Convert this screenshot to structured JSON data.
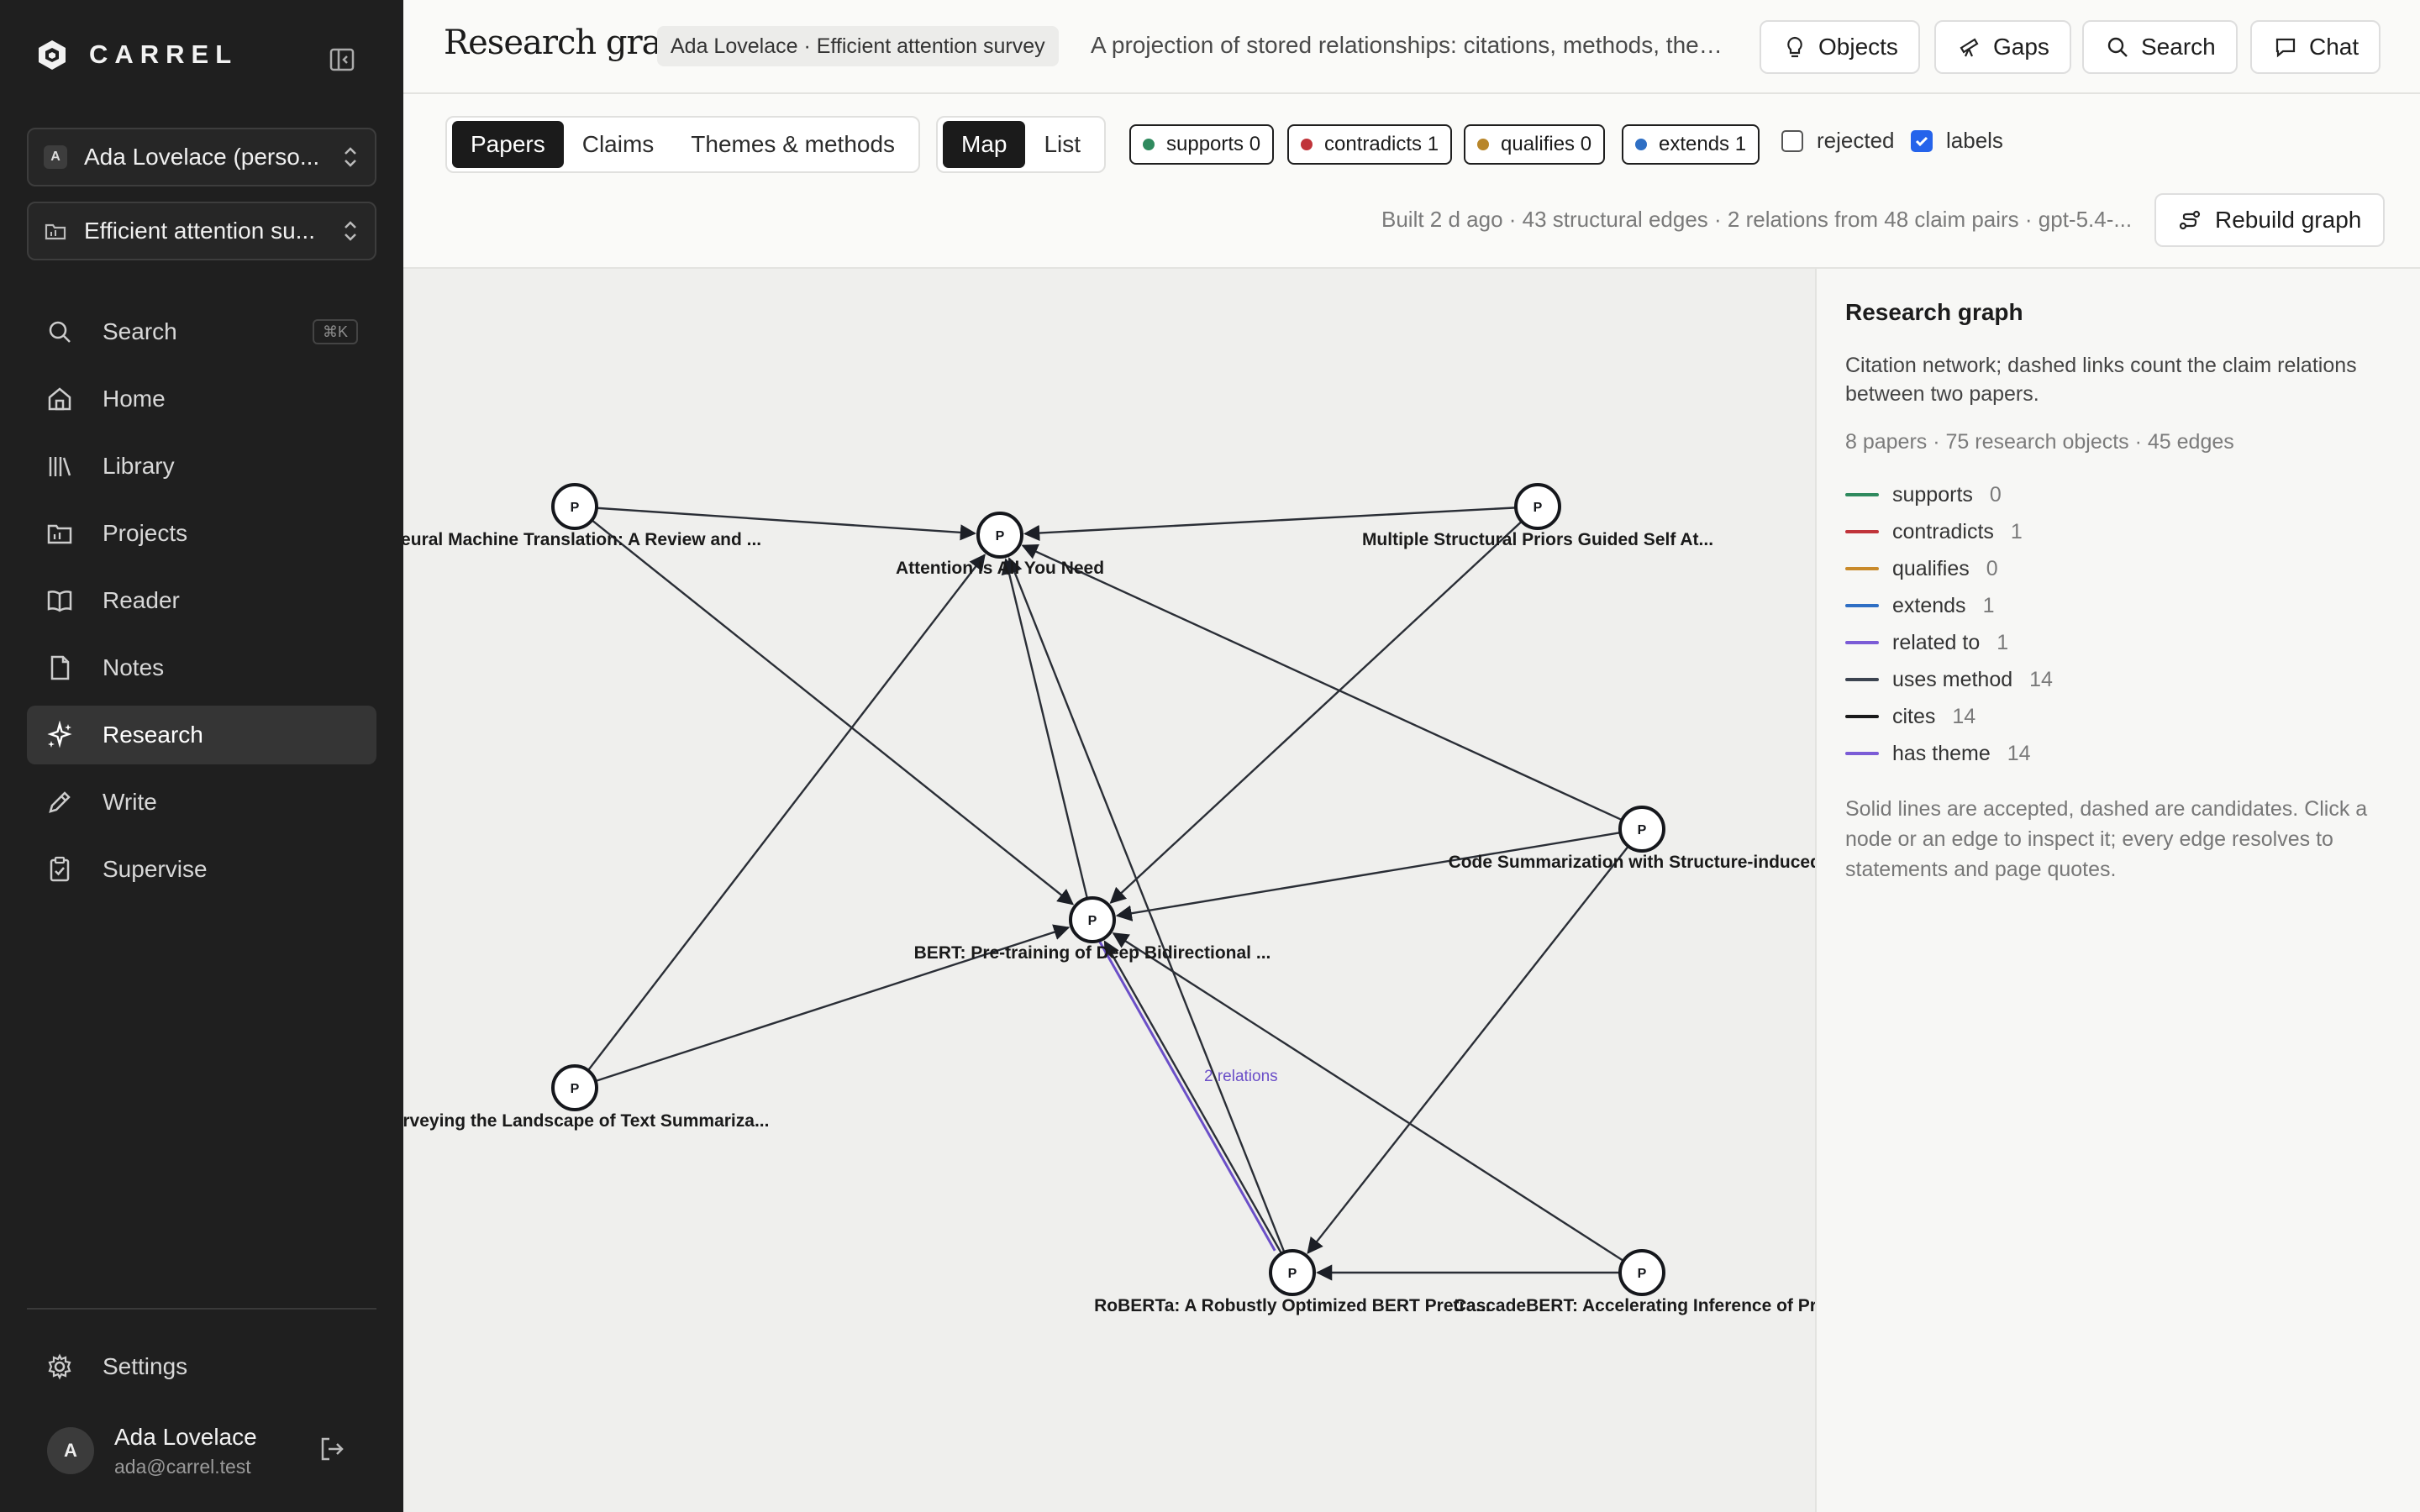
{
  "sidebar": {
    "brand": "CARREL",
    "workspace": {
      "badge": "A",
      "label": "Ada Lovelace (perso..."
    },
    "project": {
      "label": "Efficient attention su..."
    },
    "nav": [
      {
        "id": "search",
        "label": "Search",
        "shortcut": "⌘K",
        "icon": "search-icon"
      },
      {
        "id": "home",
        "label": "Home",
        "icon": "home-icon"
      },
      {
        "id": "library",
        "label": "Library",
        "icon": "library-icon"
      },
      {
        "id": "projects",
        "label": "Projects",
        "icon": "folder-icon"
      },
      {
        "id": "reader",
        "label": "Reader",
        "icon": "book-icon"
      },
      {
        "id": "notes",
        "label": "Notes",
        "icon": "note-icon"
      },
      {
        "id": "research",
        "label": "Research",
        "icon": "sparkle-icon",
        "active": true
      },
      {
        "id": "write",
        "label": "Write",
        "icon": "pen-icon"
      },
      {
        "id": "supervise",
        "label": "Supervise",
        "icon": "clipboard-icon"
      }
    ],
    "settings_label": "Settings",
    "user": {
      "initial": "A",
      "name": "Ada Lovelace",
      "email": "ada@carrel.test"
    }
  },
  "header": {
    "title": "Research graph",
    "context": "Ada Lovelace · Efficient attention survey",
    "description": "A projection of stored relationships: citations, methods, them...",
    "buttons": {
      "objects": "Objects",
      "gaps": "Gaps",
      "search": "Search",
      "chat": "Chat"
    }
  },
  "toolbar": {
    "view_tabs": [
      "Papers",
      "Claims",
      "Themes & methods"
    ],
    "active_view": "Papers",
    "layout_tabs": [
      "Map",
      "List"
    ],
    "active_layout": "Map",
    "filters": [
      {
        "label": "supports 0",
        "color": "#2f8a5e"
      },
      {
        "label": "contradicts 1",
        "color": "#c0343a"
      },
      {
        "label": "qualifies 0",
        "color": "#b8862a"
      },
      {
        "label": "extends 1",
        "color": "#2f6fc4"
      }
    ],
    "rejected": {
      "label": "rejected",
      "checked": false
    },
    "labels": {
      "label": "labels",
      "checked": true
    },
    "build_status": "Built 2 d ago · 43 structural edges · 2 relations from 48 claim pairs · gpt-5.4-...",
    "rebuild_label": "Rebuild graph"
  },
  "graph": {
    "node_marker": "P",
    "nodes": [
      {
        "id": "nmt",
        "label": "Neural Machine Translation: A Review and ..."
      },
      {
        "id": "attn",
        "label": "Attention Is All You Need"
      },
      {
        "id": "msp",
        "label": "Multiple Structural Priors Guided Self At..."
      },
      {
        "id": "code",
        "label": "Code Summarization with Structure-induced..."
      },
      {
        "id": "bert",
        "label": "BERT: Pre-training of Deep Bidirectional ..."
      },
      {
        "id": "surv",
        "label": "Surveying the Landscape of Text Summariza..."
      },
      {
        "id": "roberta",
        "label": "RoBERTa: A Robustly Optimized BERT Pretra..."
      },
      {
        "id": "cascade",
        "label": "CascadeBERT: Accelerating Inference of Pr..."
      }
    ],
    "edges": [
      {
        "from": "nmt",
        "to": "attn"
      },
      {
        "from": "nmt",
        "to": "bert"
      },
      {
        "from": "msp",
        "to": "attn"
      },
      {
        "from": "msp",
        "to": "bert"
      },
      {
        "from": "code",
        "to": "attn"
      },
      {
        "from": "code",
        "to": "bert"
      },
      {
        "from": "code",
        "to": "roberta"
      },
      {
        "from": "surv",
        "to": "attn"
      },
      {
        "from": "surv",
        "to": "bert"
      },
      {
        "from": "bert",
        "to": "attn"
      },
      {
        "from": "roberta",
        "to": "attn"
      },
      {
        "from": "roberta",
        "to": "bert"
      },
      {
        "from": "cascade",
        "to": "bert"
      },
      {
        "from": "cascade",
        "to": "roberta"
      }
    ],
    "relation_edge": {
      "from": "bert",
      "to": "roberta",
      "label": "2 relations",
      "color": "#6b4fc8"
    }
  },
  "panel": {
    "title": "Research graph",
    "description": "Citation network; dashed links count the claim relations between two papers.",
    "stats": "8 papers · 75 research objects · 45 edges",
    "legend": [
      {
        "label": "supports",
        "count": "0",
        "color": "#2f8a5e"
      },
      {
        "label": "contradicts",
        "count": "1",
        "color": "#c0343a"
      },
      {
        "label": "qualifies",
        "count": "0",
        "color": "#c98a2a"
      },
      {
        "label": "extends",
        "count": "1",
        "color": "#2f6fc4"
      },
      {
        "label": "related to",
        "count": "1",
        "color": "#7b5cd6"
      },
      {
        "label": "uses method",
        "count": "14",
        "color": "#3c4450"
      },
      {
        "label": "cites",
        "count": "14",
        "color": "#1a1a1a"
      },
      {
        "label": "has theme",
        "count": "14",
        "color": "#7b5cd6"
      }
    ],
    "note": "Solid lines are accepted, dashed are candidates. Click a node or an edge to inspect it; every edge resolves to statements and page quotes."
  }
}
